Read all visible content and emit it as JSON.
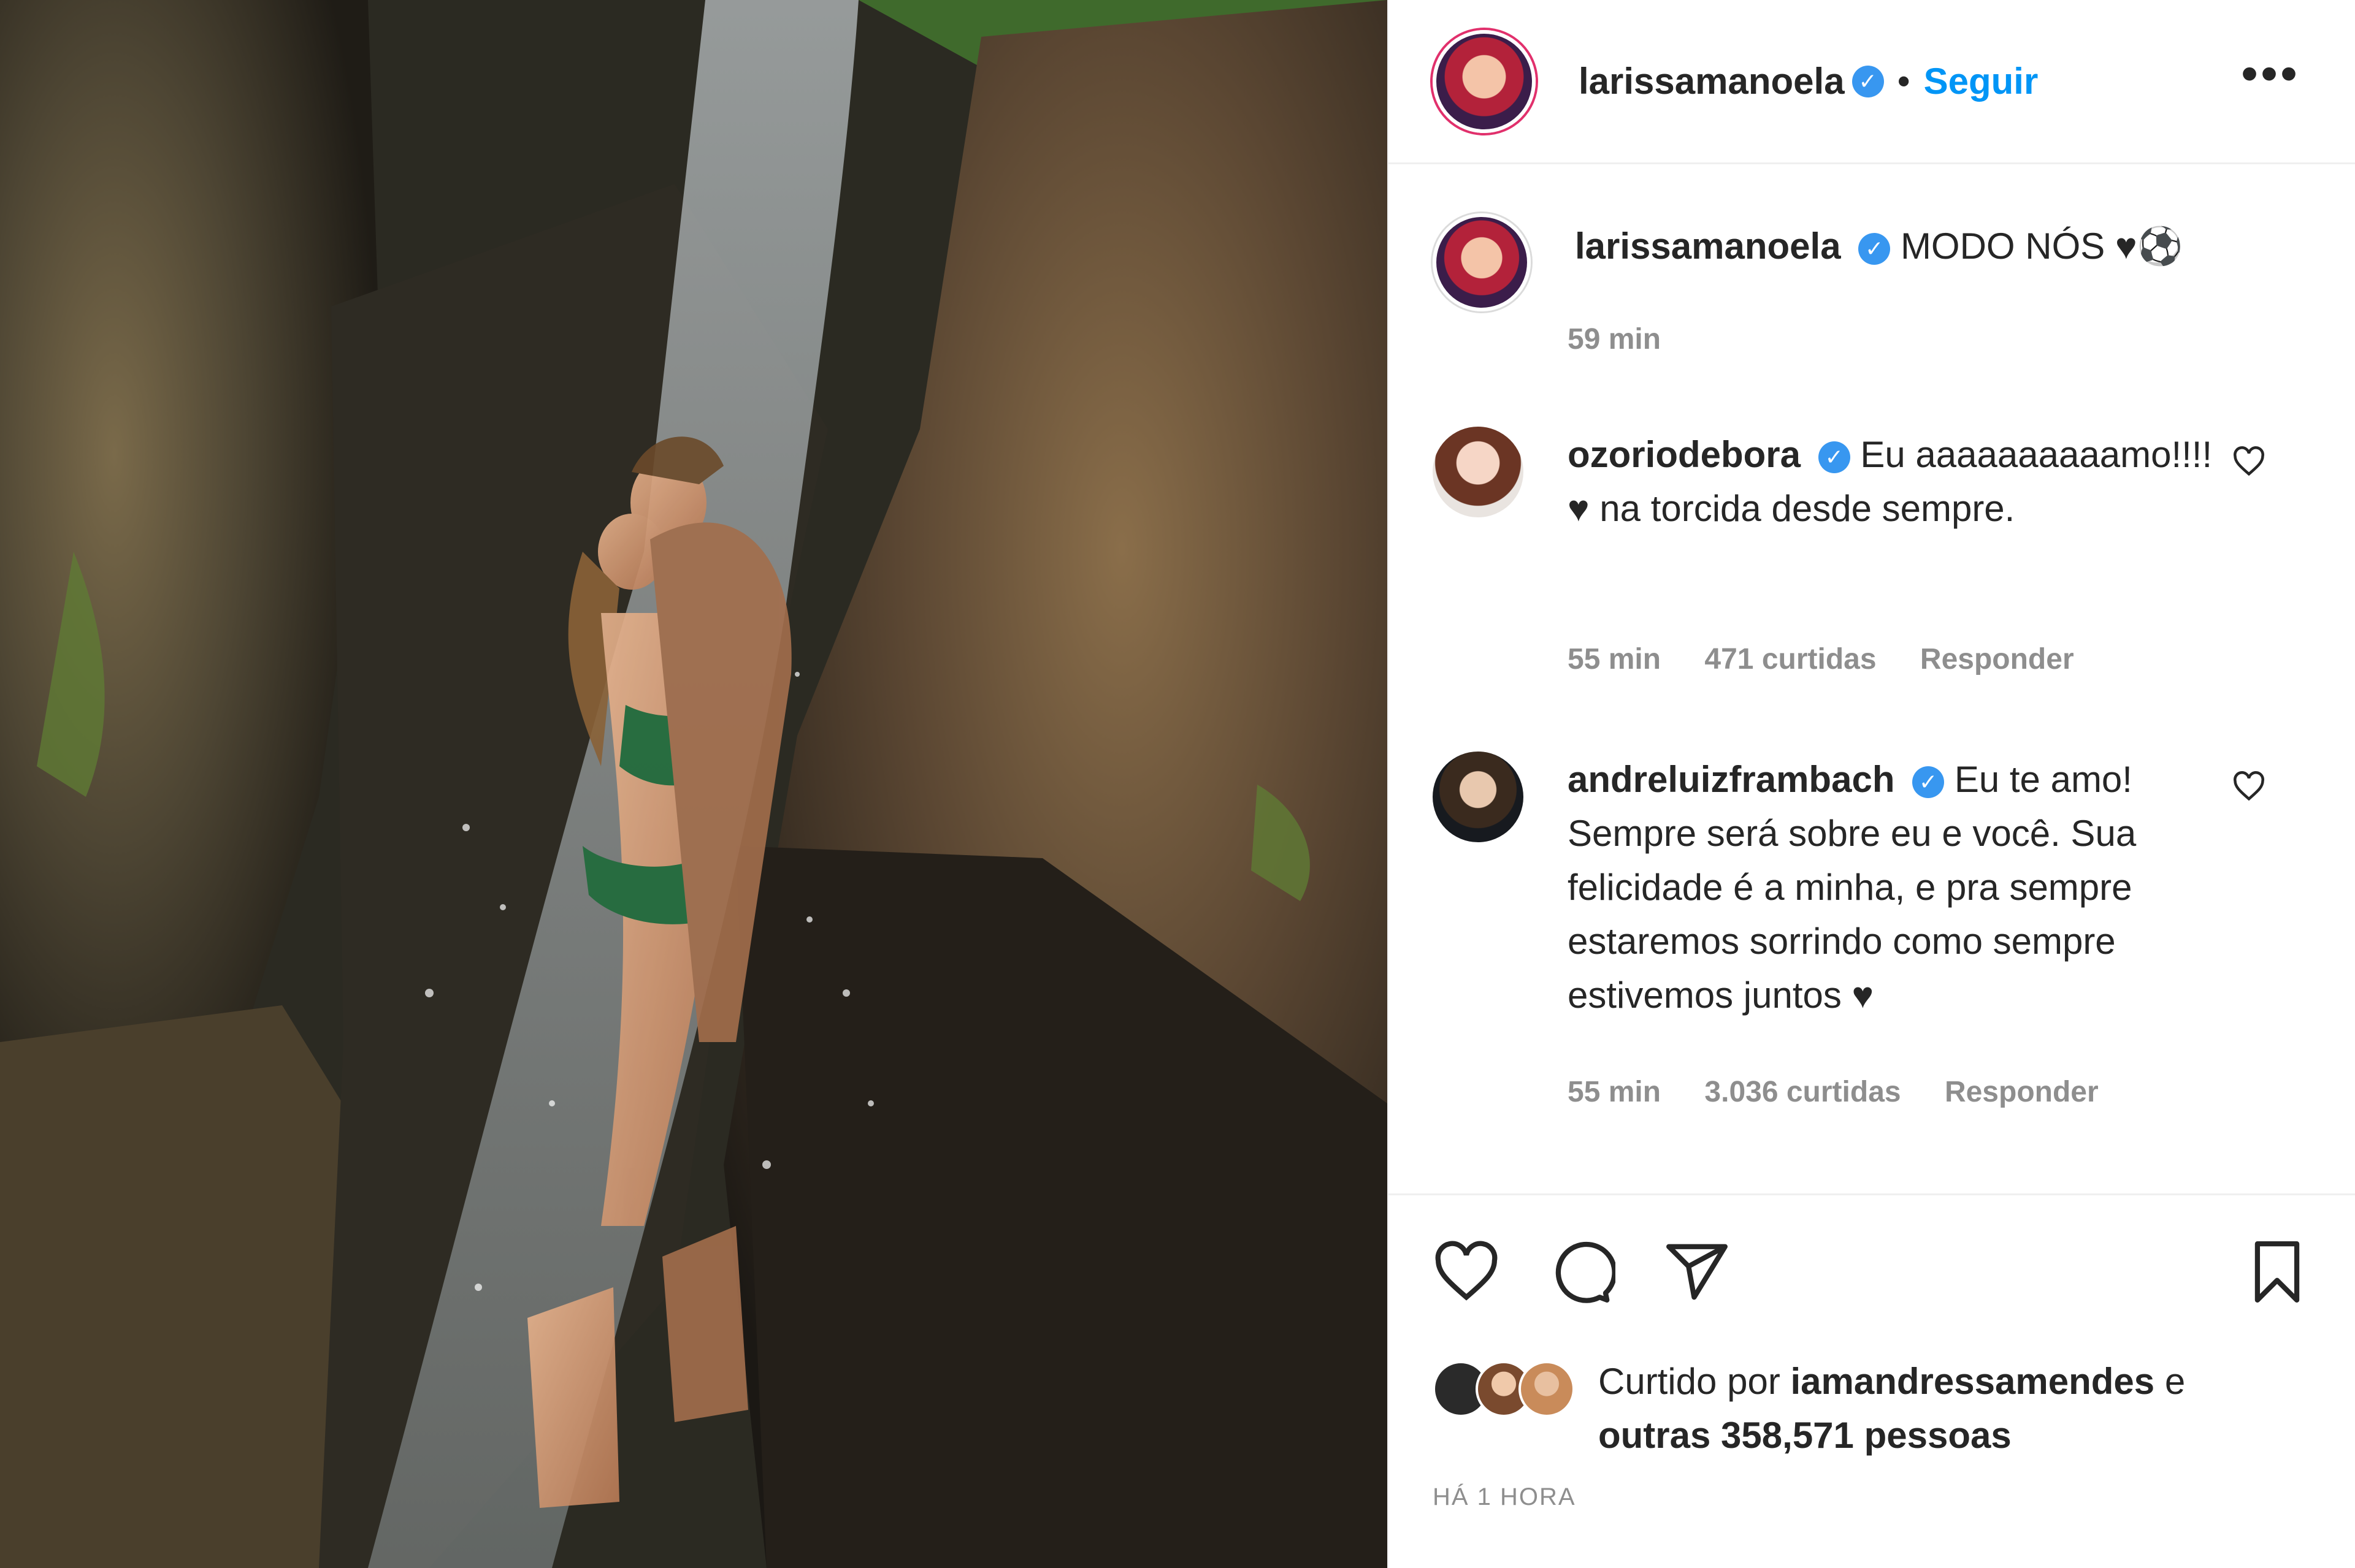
{
  "post": {
    "author": "larissamanoela",
    "follow_label": "Seguir",
    "caption_text": "MODO NÓS ♥⚽",
    "caption_time": "59 min"
  },
  "comments": [
    {
      "username": "ozoriodebora",
      "text": "Eu aaaaaaaaaamo!!!! ♥ na torcida desde sempre.",
      "time": "55 min",
      "likes": "471 curtidas",
      "reply_label": "Responder"
    },
    {
      "username": "andreluizframbach",
      "text": "Eu te amo! Sempre será sobre eu e você. Sua felicidade é a minha, e pra sempre estaremos sorrindo como sempre estivemos juntos ♥",
      "time": "55 min",
      "likes": "3.036 curtidas",
      "reply_label": "Responder"
    }
  ],
  "liked_by": {
    "prefix": "Curtido por",
    "user": "iamandressamendes",
    "connector": "e",
    "rest": "outras 358,571 pessoas"
  },
  "timestamp": "HÁ 1 HORA",
  "icons": {
    "more": "more-options-icon",
    "verified": "verified-badge-icon",
    "like": "heart-icon",
    "comment": "comment-icon",
    "share": "share-icon",
    "save": "bookmark-icon"
  }
}
